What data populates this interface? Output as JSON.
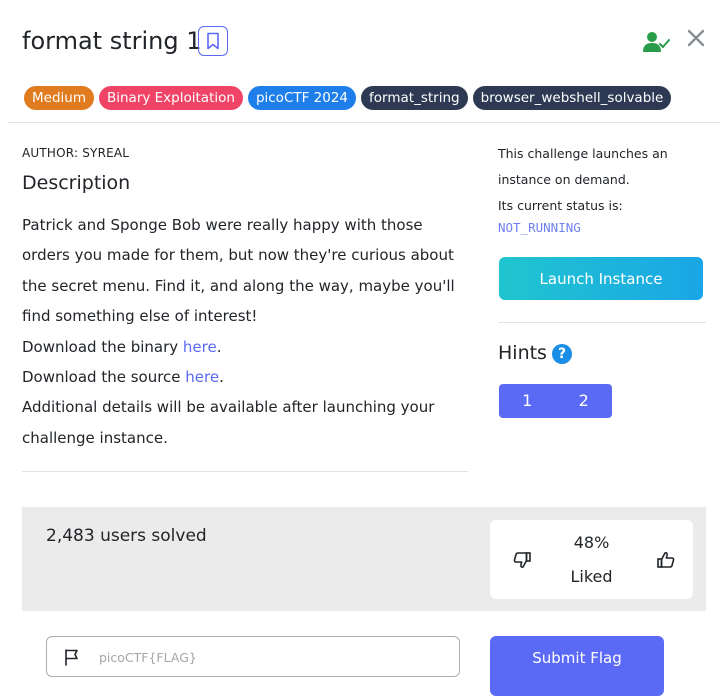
{
  "header": {
    "title": "format string 1",
    "tags": [
      {
        "label": "Medium",
        "color": "#e07b1f"
      },
      {
        "label": "Binary Exploitation",
        "color": "#ef4466"
      },
      {
        "label": "picoCTF 2024",
        "color": "#1f7fea"
      },
      {
        "label": "format_string",
        "color": "#2e3a54"
      },
      {
        "label": "browser_webshell_solvable",
        "color": "#2e3a54"
      }
    ]
  },
  "challenge": {
    "author": "AUTHOR: SYREAL",
    "description_heading": "Description",
    "paragraph": "Patrick and Sponge Bob were really happy with those orders you made for them, but now they're curious about the secret menu. Find it, and along the way, maybe you'll find something else of interest!",
    "download_binary_prefix": "Download the binary ",
    "download_source_prefix": "Download the source ",
    "link_text": "here",
    "period": ".",
    "additional": "Additional details will be available after launching your challenge instance."
  },
  "instance": {
    "line1": "This challenge launches an instance on demand.",
    "line2": "Its current status is:",
    "status": "NOT_RUNNING",
    "launch_label": "Launch Instance"
  },
  "hints": {
    "heading": "Hints",
    "help_glyph": "?",
    "buttons": [
      "1",
      "2"
    ]
  },
  "stats": {
    "solved": "2,483 users solved",
    "percent": "48%",
    "liked_label": "Liked"
  },
  "flag": {
    "placeholder": "picoCTF{FLAG}",
    "value": "",
    "submit_label": "Submit Flag"
  },
  "colors": {
    "accent": "#5b6af5",
    "success": "#2a9d4a",
    "status_text": "#6f80f0"
  },
  "icons": [
    "bookmark-icon",
    "user-check-icon",
    "close-icon",
    "help-icon",
    "thumbs-down-icon",
    "thumbs-up-icon",
    "flag-icon"
  ]
}
